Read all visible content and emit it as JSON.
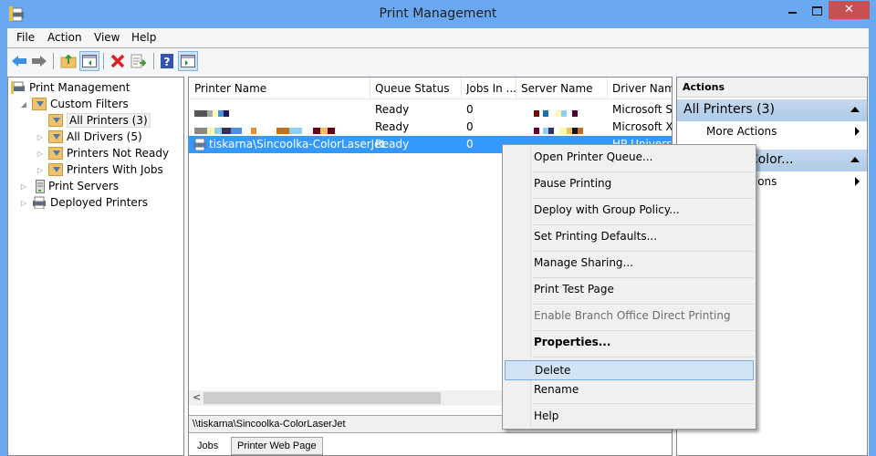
{
  "window": {
    "title": "Print Management",
    "close_glyph": "✕"
  },
  "menubar": {
    "items": [
      "File",
      "Action",
      "View",
      "Help"
    ]
  },
  "toolbar": {
    "buttons": [
      "back-icon",
      "forward-icon",
      "up-folder-icon",
      "show-hide-tree-icon",
      "delete-icon",
      "export-list-icon",
      "help-icon",
      "show-hide-action-pane-icon"
    ]
  },
  "tree": {
    "root": "Print Management",
    "custom_filters": "Custom Filters",
    "all_printers": "All Printers (3)",
    "all_drivers": "All Drivers (5)",
    "printers_not_ready": "Printers Not Ready",
    "printers_with_jobs": "Printers With Jobs",
    "print_servers": "Print Servers",
    "deployed_printers": "Deployed Printers"
  },
  "printer_list": {
    "columns": [
      "Printer Name",
      "Queue Status",
      "Jobs In ...",
      "Server Name",
      "Driver Name"
    ],
    "rows": [
      {
        "name": "",
        "status": "Ready",
        "jobs": "0",
        "server": "",
        "driver": "Microsoft Sh"
      },
      {
        "name": "",
        "status": "Ready",
        "jobs": "0",
        "server": "",
        "driver": "Microsoft XP"
      },
      {
        "name": "tiskarna\\Sincoolka-ColorLaserJet",
        "status": "Ready",
        "jobs": "0",
        "server": "",
        "driver": "HP Universa"
      }
    ],
    "scroll_left_glyph": "<"
  },
  "detail": {
    "path": "\\\\tiskarna\\Sincoolka-ColorLaserJet",
    "tabs": [
      "Jobs",
      "Printer Web Page"
    ]
  },
  "actions": {
    "header": "Actions",
    "group1": "All Printers (3)",
    "group1_more": "More Actions",
    "group2": "Sincoolka-Color...",
    "group2_more": "More Actions"
  },
  "context_menu": {
    "items": [
      {
        "label": "Open Printer Queue...",
        "state": "normal"
      },
      {
        "label": "Pause Printing",
        "state": "normal"
      },
      {
        "label": "Deploy with Group Policy...",
        "state": "normal"
      },
      {
        "label": "Set Printing Defaults...",
        "state": "normal"
      },
      {
        "label": "Manage Sharing...",
        "state": "normal"
      },
      {
        "label": "Print Test Page",
        "state": "normal"
      },
      {
        "label": "Enable Branch Office Direct Printing",
        "state": "disabled"
      },
      {
        "label": "Properties...",
        "state": "bold"
      },
      {
        "label": "Delete",
        "state": "highlighted"
      },
      {
        "label": "Rename",
        "state": "normal"
      },
      {
        "label": "Help",
        "state": "normal"
      }
    ]
  },
  "colors": {
    "titlebar": "#6aa9f2",
    "close": "#c75050",
    "selection": "#3399ff",
    "menu_highlight": "#d1e3f4"
  }
}
